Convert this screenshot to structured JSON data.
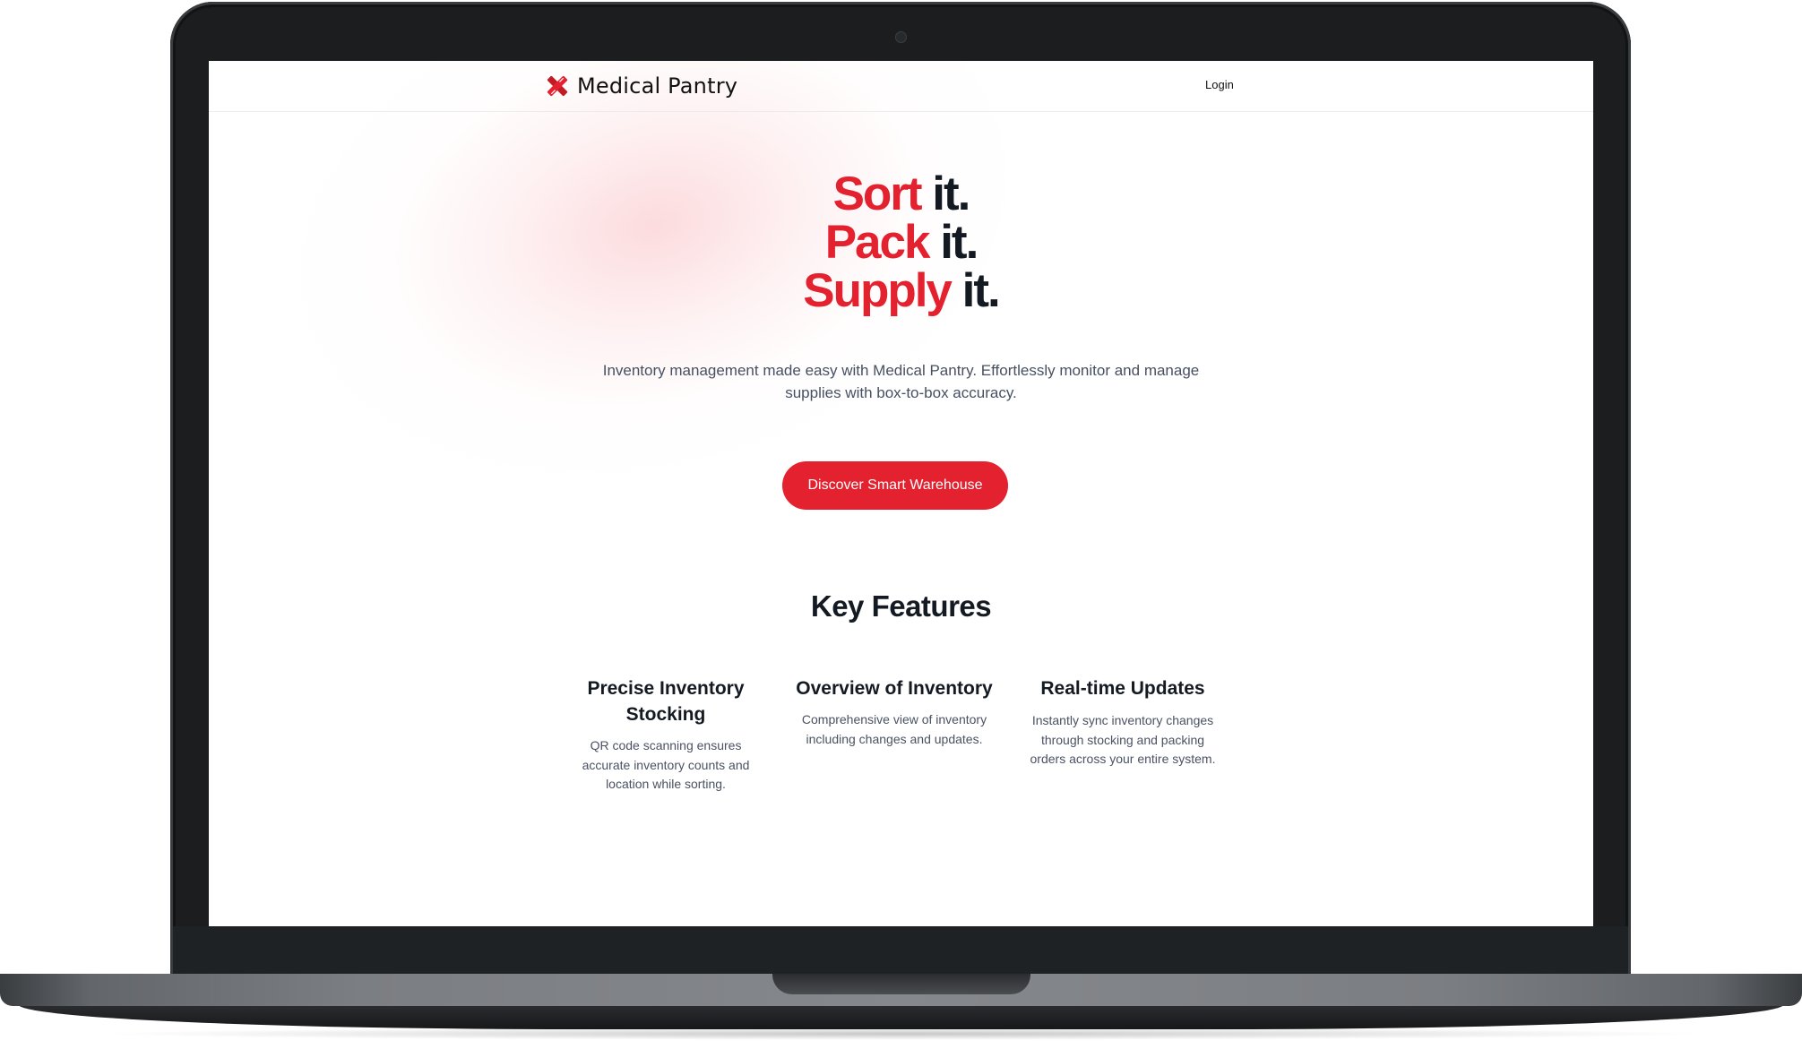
{
  "brand": {
    "name": "Medical Pantry",
    "logo_icon": "red-cross-icon",
    "accent_color": "#e3212f"
  },
  "nav": {
    "login_label": "Login"
  },
  "hero": {
    "lines": [
      {
        "highlight": "Sort",
        "rest": " it."
      },
      {
        "highlight": "Pack",
        "rest": " it."
      },
      {
        "highlight": "Supply",
        "rest": " it."
      }
    ],
    "description": "Inventory management made easy with Medical Pantry. Effortlessly monitor and manage supplies with box-to-box accuracy.",
    "cta_label": "Discover Smart Warehouse"
  },
  "features": {
    "title": "Key Features",
    "items": [
      {
        "title": "Precise Inventory Stocking",
        "description": "QR code scanning ensures accurate inventory counts and location while sorting."
      },
      {
        "title": "Overview of Inventory",
        "description": "Comprehensive view of inventory including changes and updates."
      },
      {
        "title": "Real-time Updates",
        "description": "Instantly sync inventory changes through stocking and packing orders across your entire system."
      }
    ]
  }
}
